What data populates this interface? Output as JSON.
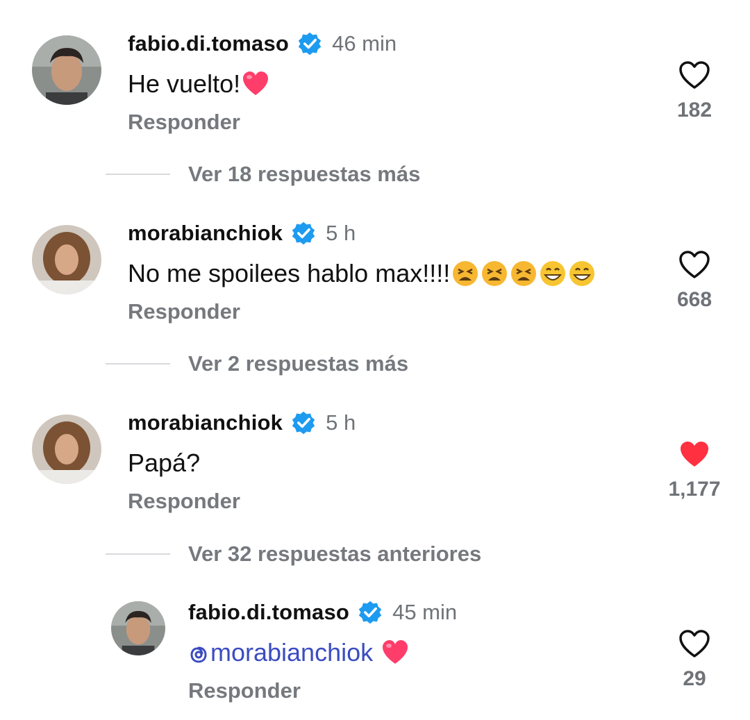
{
  "comments": [
    {
      "username": "fabio.di.tomaso",
      "time": "46 min",
      "text": "He vuelto!",
      "reply_label": "Responder",
      "like_count": "182",
      "liked": false
    },
    {
      "username": "morabianchiok",
      "time": "5 h",
      "text": "No me spoilees hablo max!!!!",
      "reply_label": "Responder",
      "like_count": "668",
      "liked": false
    },
    {
      "username": "morabianchiok",
      "time": "5 h",
      "text": "Papá?",
      "reply_label": "Responder",
      "like_count": "1,177",
      "liked": true
    },
    {
      "username": "fabio.di.tomaso",
      "time": "45 min",
      "mention": "morabianchiok",
      "reply_label": "Responder",
      "like_count": "29",
      "liked": false
    }
  ],
  "more_replies": [
    "Ver 18 respuestas más",
    "Ver 2 respuestas más",
    "Ver 32 respuestas anteriores"
  ],
  "colors": {
    "verified": "#1d9bf0",
    "liked": "#ff3040",
    "mention": "#3b4cc0",
    "muted": "#75797e"
  }
}
